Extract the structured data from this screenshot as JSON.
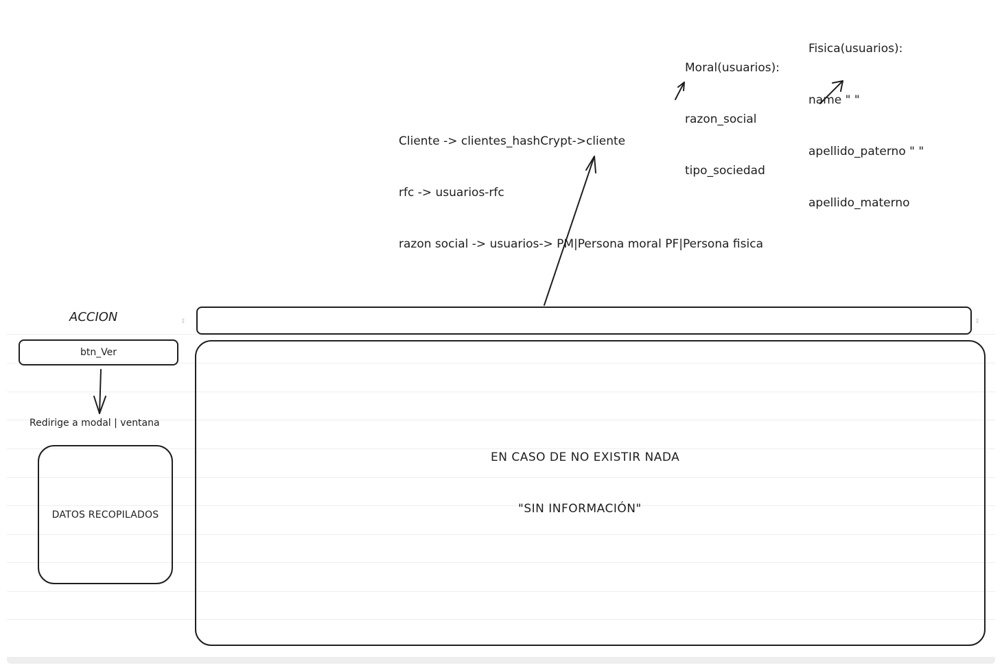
{
  "notes": {
    "moral": [
      "Moral(usuarios):",
      "razon_social",
      "tipo_sociedad"
    ],
    "fisica": [
      "Fisica(usuarios):",
      "name \" \"",
      "apellido_paterno \" \"",
      "apellido_materno"
    ],
    "mapping": [
      "Cliente -> clientes_hashCrypt->cliente",
      "rfc -> usuarios-rfc",
      "razon social -> usuarios-> PM|Persona moral PF|Persona fisica"
    ]
  },
  "table": {
    "accion_header": "ACCION",
    "sort_caret": "⇕"
  },
  "action": {
    "button_label": "btn_Ver",
    "redirect_caption": "Redirige a modal | ventana",
    "collected_label": "DATOS RECOPILADOS"
  },
  "main": {
    "empty_note": "EN CASO DE NO EXISTIR NADA",
    "empty_message": "\"SIN INFORMACIÓN\""
  }
}
